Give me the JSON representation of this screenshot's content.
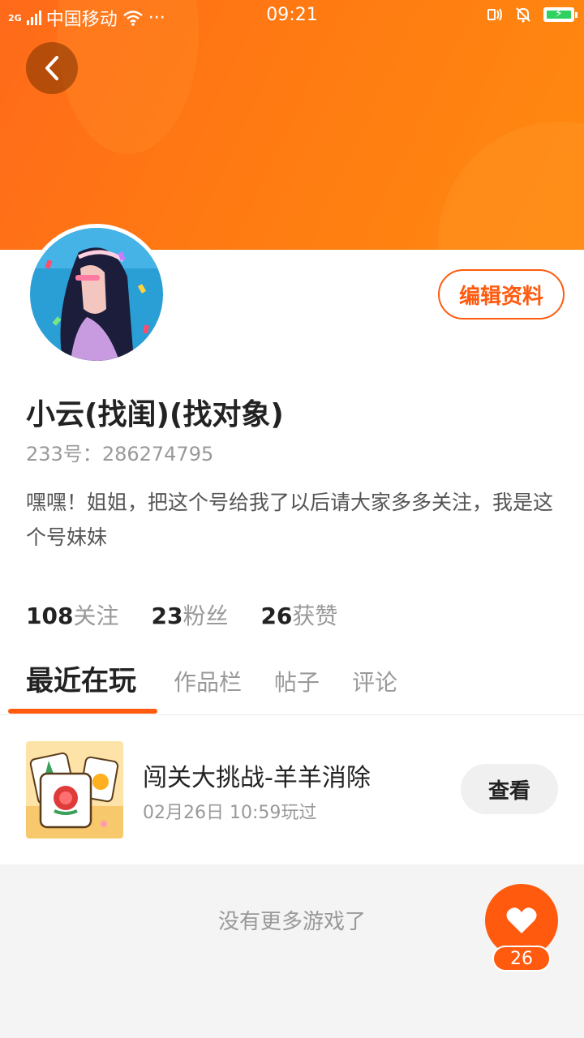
{
  "status_bar": {
    "network": "2G",
    "carrier": "中国移动",
    "more": "···",
    "time": "09:21"
  },
  "profile": {
    "name": "小云(找闺)(找对象)",
    "uid_label": "233号：",
    "uid": "286274795",
    "bio": "嘿嘿！姐姐，把这个号给我了以后请大家多多关注，我是这个号妹妹",
    "edit_label": "编辑资料"
  },
  "stats": [
    {
      "value": "108",
      "label": "关注"
    },
    {
      "value": "23",
      "label": "粉丝"
    },
    {
      "value": "26",
      "label": "获赞"
    }
  ],
  "tabs": [
    "最近在玩",
    "作品栏",
    "帖子",
    "评论"
  ],
  "active_tab": "最近在玩",
  "games": [
    {
      "title": "闯关大挑战-羊羊消除",
      "time": "02月26日 10:59玩过",
      "action": "查看"
    }
  ],
  "footer_text": "没有更多游戏了",
  "like": {
    "count": "26"
  },
  "colors": {
    "accent": "#ff5a0e",
    "header": "#ff7a12"
  }
}
